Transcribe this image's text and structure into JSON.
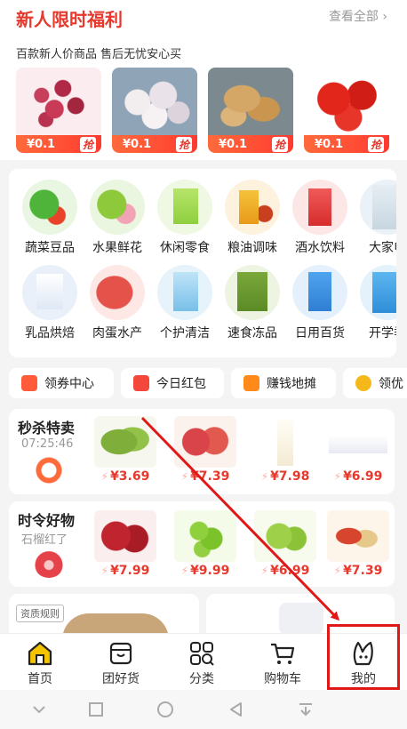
{
  "promo": {
    "title": "新人限时福利",
    "view_all": "查看全部",
    "subtitle": "百款新人价商品 售后无忧安心买",
    "items": [
      {
        "name": "grapes",
        "price": "¥0.1",
        "tag": "抢"
      },
      {
        "name": "garlic",
        "price": "¥0.1",
        "tag": "抢"
      },
      {
        "name": "ginger",
        "price": "¥0.1",
        "tag": "抢"
      },
      {
        "name": "tomatoes",
        "price": "¥0.1",
        "tag": "抢"
      }
    ]
  },
  "categories": [
    {
      "label": "蔬菜豆品",
      "icon": "vegetable-icon"
    },
    {
      "label": "水果鲜花",
      "icon": "fruit-icon"
    },
    {
      "label": "休闲零食",
      "icon": "snack-icon"
    },
    {
      "label": "粮油调味",
      "icon": "oil-icon"
    },
    {
      "label": "酒水饮料",
      "icon": "drink-icon"
    },
    {
      "label": "大家电",
      "icon": "appliance-icon"
    },
    {
      "label": "乳品烘焙",
      "icon": "dairy-icon"
    },
    {
      "label": "肉蛋水产",
      "icon": "meat-icon"
    },
    {
      "label": "个护清洁",
      "icon": "cleaning-icon"
    },
    {
      "label": "速食冻品",
      "icon": "frozen-icon"
    },
    {
      "label": "日用百货",
      "icon": "daily-icon"
    },
    {
      "label": "开学季",
      "icon": "school-icon"
    }
  ],
  "chips": [
    {
      "label": "领券中心"
    },
    {
      "label": "今日红包"
    },
    {
      "label": "赚钱地摊"
    },
    {
      "label": "领优"
    }
  ],
  "flash_sale": {
    "title": "秒杀特卖",
    "countdown": "07:25:46",
    "products": [
      {
        "name": "edamame",
        "price": "¥3.69"
      },
      {
        "name": "apples",
        "price": "¥7.39"
      },
      {
        "name": "fresh-milk",
        "price": "¥7.98"
      },
      {
        "name": "box-item",
        "price": "¥6.99"
      }
    ]
  },
  "seasonal": {
    "title": "时令好物",
    "subtitle": "石榴红了",
    "products": [
      {
        "name": "pomegranate",
        "price": "¥7.99"
      },
      {
        "name": "green-grapes",
        "price": "¥9.99"
      },
      {
        "name": "fruit",
        "price": "¥6.99"
      },
      {
        "name": "jujube",
        "price": "¥7.39"
      }
    ]
  },
  "bottom_cards": {
    "tag": "资质规则"
  },
  "tabbar": [
    {
      "label": "首页",
      "icon": "home-icon",
      "active": true
    },
    {
      "label": "团好货",
      "icon": "bag-icon"
    },
    {
      "label": "分类",
      "icon": "category-icon"
    },
    {
      "label": "购物车",
      "icon": "cart-icon"
    },
    {
      "label": "我的",
      "icon": "profile-icon"
    }
  ],
  "colors": {
    "accent": "#e8382c",
    "highlight": "#e01818",
    "home_active": "#f5c400"
  }
}
